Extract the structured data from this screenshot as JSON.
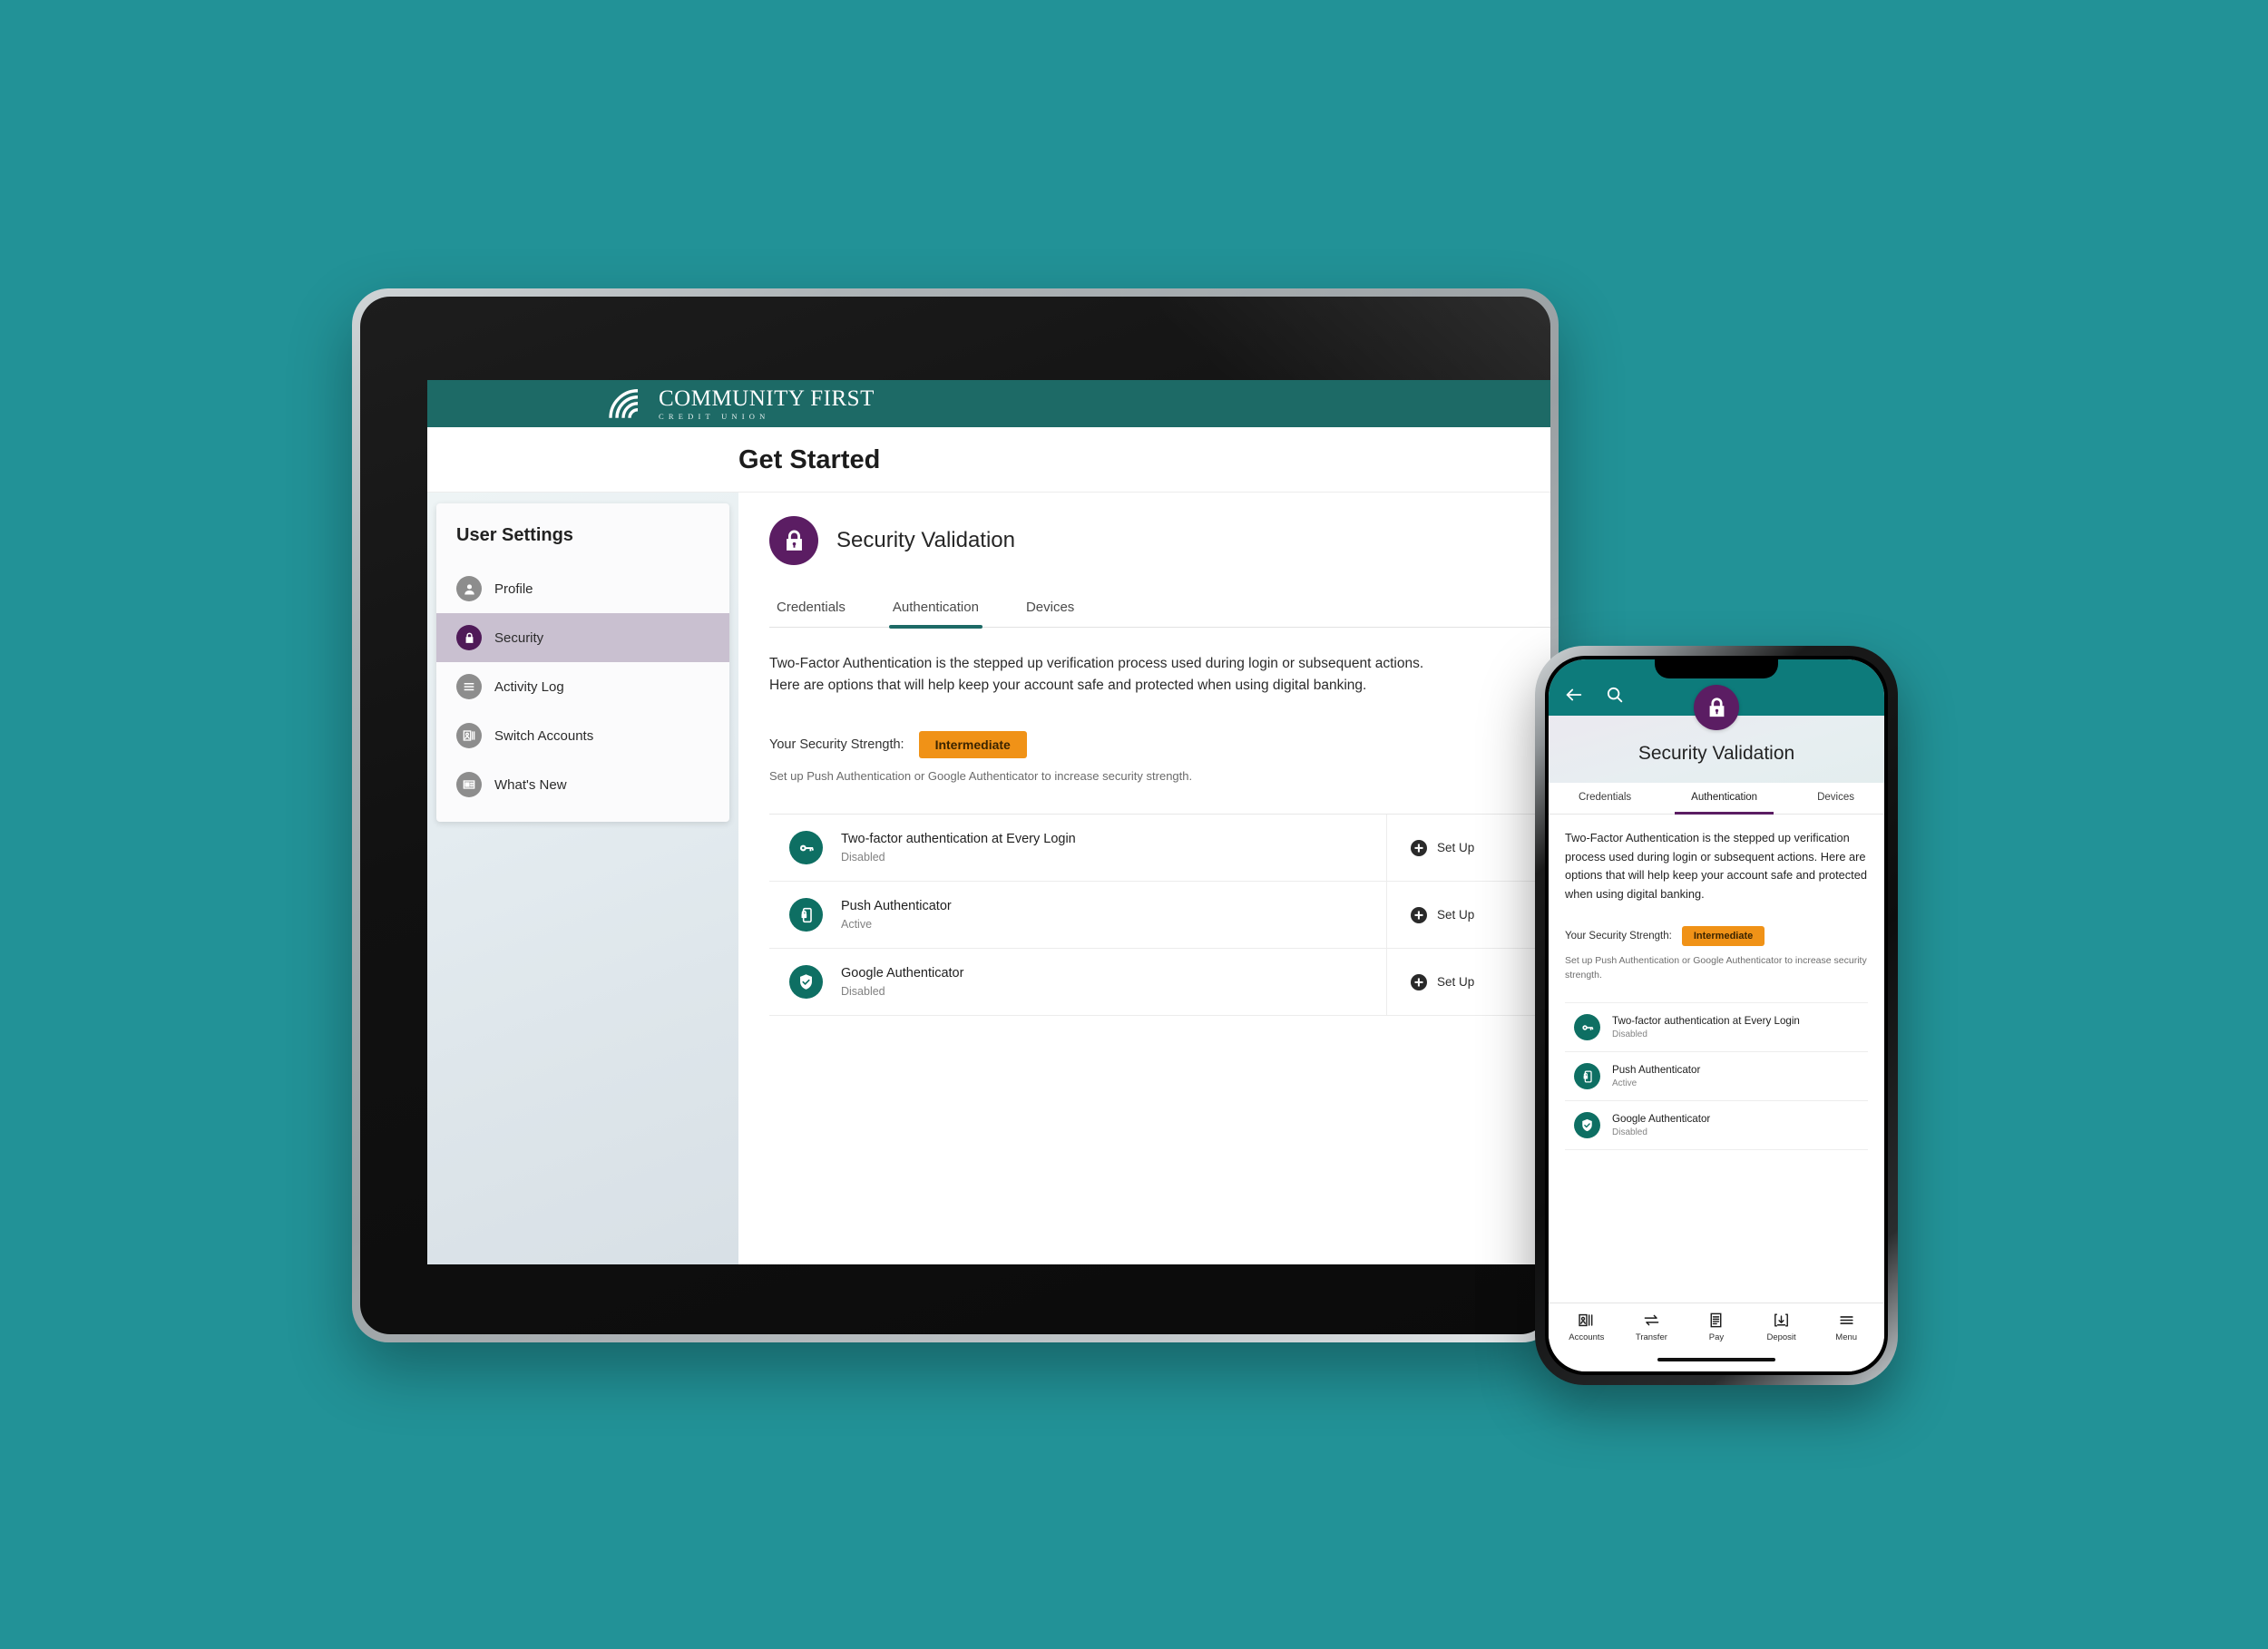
{
  "theme": {
    "page_background": "#229297",
    "app_header_teal": "#1d6a66",
    "phone_header_teal": "#0d7b7b",
    "lock_purple": "#5b1d63",
    "option_icon_teal": "#0e6f63",
    "badge_orange": "#f09217",
    "active_sidebar": "#c9c0d0"
  },
  "tablet": {
    "brand": {
      "name": "COMMUNITY FIRST",
      "tagline": "CREDIT UNION",
      "logo_icon": "arcs-mark-icon"
    },
    "dialog": {
      "title": "Get Started",
      "close_icon": "close-icon",
      "close_label": "✕"
    },
    "sidebar": {
      "heading": "User Settings",
      "items": [
        {
          "label": "Profile",
          "icon": "user-circle-icon",
          "active": false
        },
        {
          "label": "Security",
          "icon": "lock-icon",
          "active": true
        },
        {
          "label": "Activity Log",
          "icon": "list-lines-icon",
          "active": false
        },
        {
          "label": "Switch Accounts",
          "icon": "switch-accounts-icon",
          "active": false
        },
        {
          "label": "What's New",
          "icon": "news-icon",
          "active": false
        }
      ]
    },
    "main": {
      "page_icon": "lock-badge-icon",
      "page_title": "Security Validation",
      "tabs": [
        {
          "label": "Credentials",
          "active": false
        },
        {
          "label": "Authentication",
          "active": true
        },
        {
          "label": "Devices",
          "active": false
        }
      ],
      "description_line_1": "Two-Factor Authentication is the stepped up verification process used during login or subsequent actions.",
      "description_line_2": "Here are options that will help keep your account safe and protected when using digital banking.",
      "strength_label": "Your Security Strength:",
      "strength_value": "Intermediate",
      "strength_hint": "Set up Push Authentication or Google Authenticator to increase security strength.",
      "options": [
        {
          "name": "Two-factor authentication at Every Login",
          "status": "Disabled",
          "icon": "key-icon",
          "action": "Set Up",
          "action_icon": "plus-circle-icon"
        },
        {
          "name": "Push Authenticator",
          "status": "Active",
          "icon": "phone-lock-icon",
          "action": "Set Up",
          "action_icon": "plus-circle-icon"
        },
        {
          "name": "Google Authenticator",
          "status": "Disabled",
          "icon": "shield-check-icon",
          "action": "Set Up",
          "action_icon": "plus-circle-icon"
        }
      ]
    }
  },
  "phone": {
    "header": {
      "back_icon": "arrow-left-icon",
      "search_icon": "search-icon",
      "lock_icon": "lock-badge-icon"
    },
    "page_title": "Security Validation",
    "tabs": [
      {
        "label": "Credentials",
        "active": false
      },
      {
        "label": "Authentication",
        "active": true
      },
      {
        "label": "Devices",
        "active": false
      }
    ],
    "description": "Two-Factor Authentication is the stepped up verification process used during login or subsequent actions.\nHere are options that will help keep your account safe and protected when using digital banking.",
    "strength_label": "Your Security Strength:",
    "strength_value": "Intermediate",
    "strength_hint": "Set up Push Authentication or Google Authenticator to increase security strength.",
    "options": [
      {
        "name": "Two-factor authentication at Every Login",
        "status": "Disabled",
        "icon": "key-icon"
      },
      {
        "name": "Push Authenticator",
        "status": "Active",
        "icon": "phone-lock-icon"
      },
      {
        "name": "Google Authenticator",
        "status": "Disabled",
        "icon": "shield-check-icon"
      }
    ],
    "bottom_nav": [
      {
        "label": "Accounts",
        "icon": "accounts-icon"
      },
      {
        "label": "Transfer",
        "icon": "transfer-arrows-icon"
      },
      {
        "label": "Pay",
        "icon": "pay-bill-icon"
      },
      {
        "label": "Deposit",
        "icon": "deposit-icon"
      },
      {
        "label": "Menu",
        "icon": "hamburger-menu-icon"
      }
    ]
  }
}
